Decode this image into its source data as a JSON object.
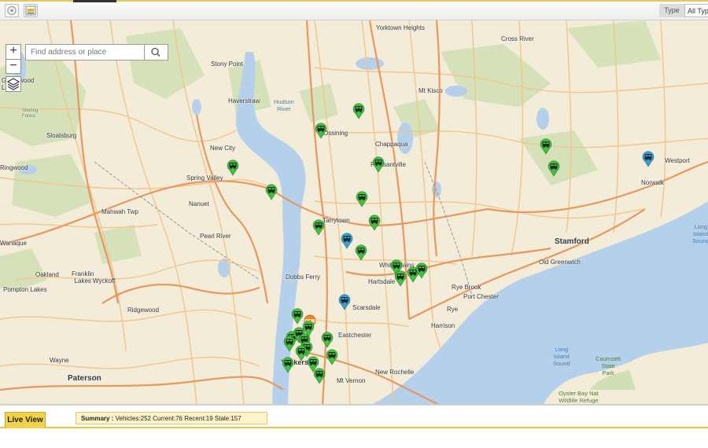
{
  "toolbar": {
    "type_label": "Type",
    "type_value": "All Typ"
  },
  "search": {
    "placeholder": "Find address or place"
  },
  "zoom": {
    "in_label": "+",
    "out_label": "−"
  },
  "map": {
    "towns": [
      {
        "label": "Yorktown\nHeights"
      },
      {
        "label": "Cross River"
      },
      {
        "label": "Stony Point"
      },
      {
        "label": "Greenwood\nLake"
      },
      {
        "label": "Haverstraw"
      },
      {
        "label": "Mt Kisco"
      },
      {
        "label": "Sterling\nForest"
      },
      {
        "label": "Ossining"
      },
      {
        "label": "Chappaqua"
      },
      {
        "label": "Sloatsburg"
      },
      {
        "label": "New City"
      },
      {
        "label": "Pleasantville"
      },
      {
        "label": "Westport"
      },
      {
        "label": "Ringwood"
      },
      {
        "label": "Spring Valley"
      },
      {
        "label": "Norwalk"
      },
      {
        "label": "Mahwah Twp"
      },
      {
        "label": "Nanuet"
      },
      {
        "label": "Tarrytown"
      },
      {
        "label": "Pearl River"
      },
      {
        "label": "Stamford"
      },
      {
        "label": "Wanaque"
      },
      {
        "label": "Old Greenwich"
      },
      {
        "label": "White Plains"
      },
      {
        "label": "Oakland"
      },
      {
        "label": "Franklin\nLakes"
      },
      {
        "label": "Wyckoff"
      },
      {
        "label": "Dobbs Ferry"
      },
      {
        "label": "Hartsdale"
      },
      {
        "label": "Rye Brook"
      },
      {
        "label": "Pompton Lakes"
      },
      {
        "label": "Port Chester"
      },
      {
        "label": "Ridgewood"
      },
      {
        "label": "Rye"
      },
      {
        "label": "Scarsdale"
      },
      {
        "label": "Harrison"
      },
      {
        "label": "Eastchester"
      },
      {
        "label": "Wayne"
      },
      {
        "label": "Yonkers"
      },
      {
        "label": "New Rochelle"
      },
      {
        "label": "Paterson"
      },
      {
        "label": "Mt Vernon"
      }
    ],
    "water_labels": [
      {
        "label": "Hudson\nRiver"
      },
      {
        "label": "Long\nIsland\nSound"
      },
      {
        "label": "Long\nIsland\nSound"
      },
      {
        "label": "Caumsett\nState\nPark"
      },
      {
        "label": "Oyster Bay Nat\nWildlife Refuge"
      }
    ],
    "colors": {
      "land": "#f3ecd9",
      "water": "#b4d0ea",
      "park": "#cfe0b4",
      "highway": "#e8975f",
      "road": "#f2c58d",
      "marker_current": "#3cc43c",
      "marker_stale": "#2ea3db",
      "marker_recent": "#f0892c"
    }
  },
  "markers": [
    {
      "status": "current"
    },
    {
      "status": "current"
    },
    {
      "status": "current"
    },
    {
      "status": "current"
    },
    {
      "status": "current"
    },
    {
      "status": "current"
    },
    {
      "status": "current"
    },
    {
      "status": "current"
    },
    {
      "status": "current"
    },
    {
      "status": "current"
    },
    {
      "status": "stale"
    },
    {
      "status": "current"
    },
    {
      "status": "current"
    },
    {
      "status": "current"
    },
    {
      "status": "current"
    },
    {
      "status": "current"
    },
    {
      "status": "stale"
    },
    {
      "status": "current"
    },
    {
      "status": "current"
    },
    {
      "status": "current"
    },
    {
      "status": "current"
    },
    {
      "status": "current"
    },
    {
      "status": "current"
    },
    {
      "status": "current"
    },
    {
      "status": "current"
    },
    {
      "status": "current"
    },
    {
      "status": "stale"
    },
    {
      "status": "current"
    },
    {
      "status": "current"
    },
    {
      "status": "recent",
      "label": "DEM"
    },
    {
      "status": "current"
    },
    {
      "status": "current"
    }
  ],
  "bottom": {
    "tab_label": "Live View",
    "summary_label": "Summary :",
    "summary_text": "Vehicles:252 Current:76 Recent:19 Stale:157"
  }
}
